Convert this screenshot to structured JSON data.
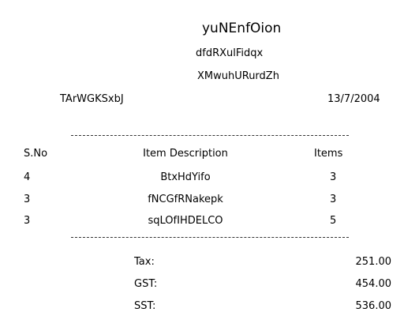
{
  "receipt": {
    "title": "yuNEnfOion",
    "subtitle_1": "dfdRXulFidqx",
    "subtitle_2": "XMwuhURurdZh",
    "customer": "TArWGKSxbJ",
    "date": "13/7/2004"
  },
  "table": {
    "headers": [
      "S.No",
      "Item Description",
      "Items"
    ],
    "rows": [
      {
        "sno": "4",
        "description": "BtxHdYifo",
        "items": "3"
      },
      {
        "sno": "3",
        "description": "fNCGfRNakepk",
        "items": "3"
      },
      {
        "sno": "3",
        "description": "sqLOfIHDELCO",
        "items": "5"
      }
    ]
  },
  "totals": [
    {
      "label": "Tax:",
      "value": "251.00"
    },
    {
      "label": "GST:",
      "value": "454.00"
    },
    {
      "label": "SST:",
      "value": "536.00"
    }
  ]
}
